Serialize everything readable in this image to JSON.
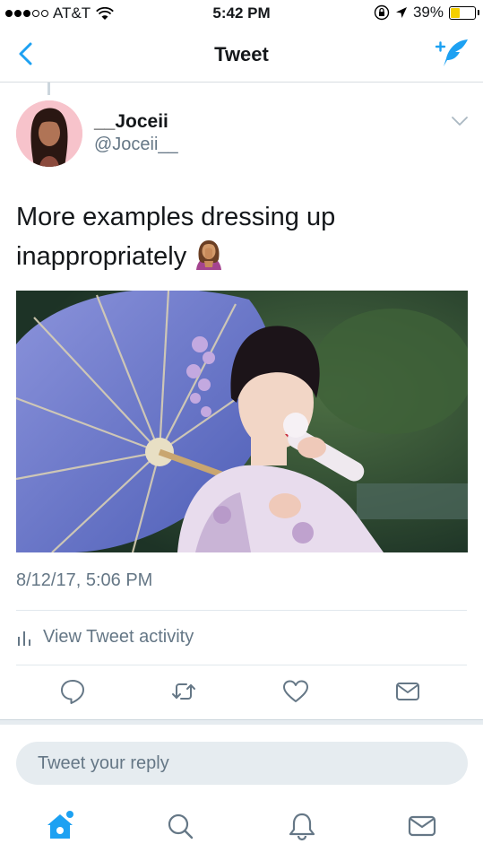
{
  "status_bar": {
    "carrier": "AT&T",
    "time": "5:42 PM",
    "battery": "39%",
    "battery_level": 0.39
  },
  "nav": {
    "title": "Tweet"
  },
  "tweet": {
    "display_name": "__Joceii",
    "handle": "@Joceii__",
    "text": "More examples dressing up inappropriately",
    "timestamp": "8/12/17, 5:06 PM"
  },
  "activity": {
    "label": "View Tweet activity"
  },
  "reply": {
    "placeholder": "Tweet your reply"
  },
  "colors": {
    "accent": "#1da1f2",
    "icon_gray": "#657786"
  },
  "icons": {
    "back": "chevron-left-icon",
    "compose": "compose-tweet-icon",
    "more": "chevron-down-icon",
    "activity": "bar-chart-icon",
    "reply": "reply-icon",
    "retweet": "retweet-icon",
    "like": "heart-icon",
    "dm": "envelope-icon",
    "home": "home-icon",
    "search": "search-icon",
    "notifications": "bell-icon",
    "messages": "envelope-icon"
  }
}
